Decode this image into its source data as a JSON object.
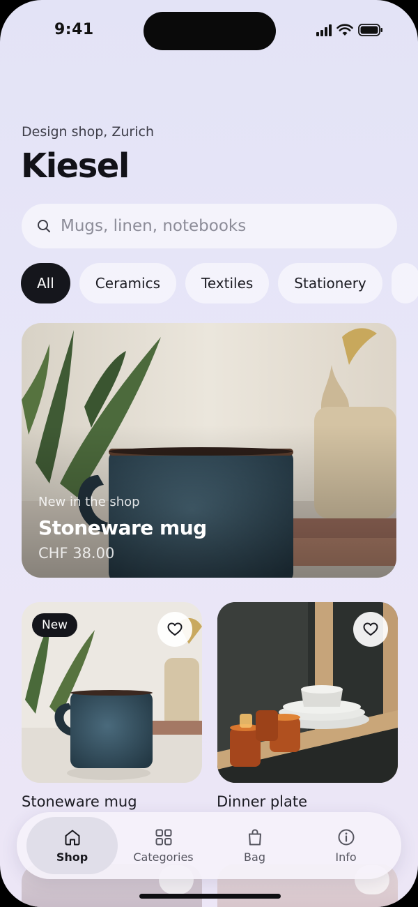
{
  "status_bar": {
    "time": "9:41"
  },
  "header": {
    "subtitle": "Design shop, Zurich",
    "title": "Kiesel"
  },
  "search": {
    "placeholder": "Mugs, linen, notebooks"
  },
  "categories": [
    {
      "label": "All",
      "active": true
    },
    {
      "label": "Ceramics",
      "active": false
    },
    {
      "label": "Textiles",
      "active": false
    },
    {
      "label": "Stationery",
      "active": false
    }
  ],
  "hero": {
    "kicker": "New in the shop",
    "name": "Stoneware mug",
    "price": "CHF 38.00"
  },
  "products": [
    {
      "name": "Stoneware mug",
      "badge": "New"
    },
    {
      "name": "Dinner plate"
    }
  ],
  "tab_bar": {
    "tabs": [
      {
        "label": "Shop",
        "icon": "home-icon",
        "active": true
      },
      {
        "label": "Categories",
        "icon": "grid-icon",
        "active": false
      },
      {
        "label": "Bag",
        "icon": "bag-icon",
        "active": false
      },
      {
        "label": "Info",
        "icon": "info-icon",
        "active": false
      }
    ]
  },
  "colors": {
    "accent_dark": "#15161c",
    "background": "#e6e4f7"
  }
}
